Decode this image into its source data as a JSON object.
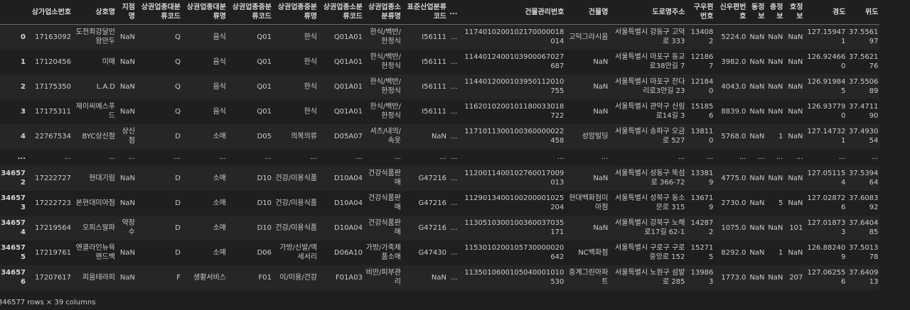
{
  "columns": [
    "",
    "상가업소번호",
    "상호명",
    "지점명",
    "상권업종대분류코드",
    "상권업종대분류명",
    "상권업종중분류코드",
    "상권업종중분류명",
    "상권업종소분류코드",
    "상권업종소분류명",
    "표준산업분류코드",
    "...",
    "건물관리번호",
    "건물명",
    "도로명주소",
    "구우편번호",
    "신우편번호",
    "동정보",
    "층정보",
    "호정보",
    "경도",
    "위도"
  ],
  "rows": [
    [
      "0",
      "17163092",
      "도전최강달인왕만두",
      "NaN",
      "Q",
      "음식",
      "Q01",
      "한식",
      "Q01A01",
      "한식/백반/한정식",
      "I56111",
      "...",
      "1174010200102170000018014",
      "고덕그라시움",
      "서울특별시 강동구 고덕로 333",
      "134082",
      "5224.0",
      "NaN",
      "NaN",
      "NaN",
      "127.159471",
      "37.556197"
    ],
    [
      "1",
      "17120456",
      "이때",
      "NaN",
      "Q",
      "음식",
      "Q01",
      "한식",
      "Q01A01",
      "한식/백반/한정식",
      "I56111",
      "...",
      "1144012400103900067027687",
      "NaN",
      "서울특별시 마포구 동교로38안길 7",
      "121867",
      "3982.0",
      "NaN",
      "NaN",
      "NaN",
      "126.924660",
      "37.562176"
    ],
    [
      "2",
      "17175350",
      "L.A.D",
      "NaN",
      "Q",
      "음식",
      "Q01",
      "한식",
      "Q01A01",
      "한식/백반/한정식",
      "I56111",
      "...",
      "1144012000103950112010755",
      "NaN",
      "서울특별시 마포구 잔다리로3안길 23",
      "121840",
      "4043.0",
      "NaN",
      "NaN",
      "NaN",
      "126.919845",
      "37.550689"
    ],
    [
      "3",
      "17175311",
      "제이씨에스푸드",
      "NaN",
      "Q",
      "음식",
      "Q01",
      "한식",
      "Q01A01",
      "한식/백반/한정식",
      "I56111",
      "...",
      "1162010200101180033018722",
      "NaN",
      "서울특별시 관악구 신림로14길 3",
      "151856",
      "8839.0",
      "NaN",
      "NaN",
      "NaN",
      "126.937790",
      "37.471190"
    ],
    [
      "4",
      "22767534",
      "BYC상신점",
      "상신점",
      "D",
      "소매",
      "D05",
      "의복의류",
      "D05A07",
      "셔츠/내의/속옷",
      "NaN",
      "...",
      "1171011300100360000022458",
      "성암빌딩",
      "서울특별시 송파구 오금로 527",
      "138110",
      "5768.0",
      "NaN",
      "1",
      "NaN",
      "127.147321",
      "37.493054"
    ],
    [
      "...",
      "...",
      "...",
      "...",
      "...",
      "...",
      "...",
      "...",
      "...",
      "...",
      "...",
      "...",
      "...",
      "...",
      "...",
      "...",
      "...",
      "...",
      "...",
      "...",
      "...",
      "..."
    ],
    [
      "346572",
      "17222727",
      "현대기림",
      "NaN",
      "D",
      "소매",
      "D10",
      "건강/미용식품",
      "D10A04",
      "건강식품판매",
      "G47216",
      "...",
      "1120011400102760017009013",
      "NaN",
      "서울특별시 성동구 뚝섬로 366-72",
      "133819",
      "4775.0",
      "NaN",
      "NaN",
      "NaN",
      "127.051154",
      "37.539464"
    ],
    [
      "346573",
      "17222723",
      "본현대미아점",
      "NaN",
      "D",
      "소매",
      "D10",
      "건강/미용식품",
      "D10A04",
      "건강식품판매",
      "G47216",
      "...",
      "1129013400100200001025204",
      "현대백화점미아점",
      "서울특별시 성북구 동소문로 315",
      "136719",
      "2730.0",
      "NaN",
      "5",
      "NaN",
      "127.028726",
      "37.608392"
    ],
    [
      "346574",
      "17219564",
      "오피스알파",
      "약장수",
      "D",
      "소매",
      "D10",
      "건강/미용식품",
      "D10A04",
      "건강식품판매",
      "G47216",
      "...",
      "1130510300100360037035171",
      "NaN",
      "서울특별시 강북구 노해로17길 62-1",
      "142872",
      "1075.0",
      "NaN",
      "NaN",
      "101",
      "127.018733",
      "37.640485"
    ],
    [
      "346575",
      "17219761",
      "엔클라인뉴욕핸드백",
      "NaN",
      "D",
      "소매",
      "D06",
      "가방/신발/액세서리",
      "D06A10",
      "가방/가죽제품소매",
      "G47430",
      "...",
      "1153010200105730000020642",
      "NC백화점",
      "서울특별시 구로구 구로중앙로 152",
      "152715",
      "8292.0",
      "NaN",
      "1",
      "NaN",
      "126.882409",
      "37.501378"
    ],
    [
      "346576",
      "17207617",
      "피움테라피",
      "NaN",
      "F",
      "생활서비스",
      "F01",
      "이/미용/건강",
      "F01A03",
      "비만/피부관리",
      "NaN",
      "...",
      "1135010600105040001010530",
      "중계그린아파트",
      "서울특별시 노원구 섬밭로 285",
      "139863",
      "1773.0",
      "NaN",
      "NaN",
      "207",
      "127.062556",
      "37.640913"
    ]
  ],
  "footer": "346577 rows × 39 columns"
}
